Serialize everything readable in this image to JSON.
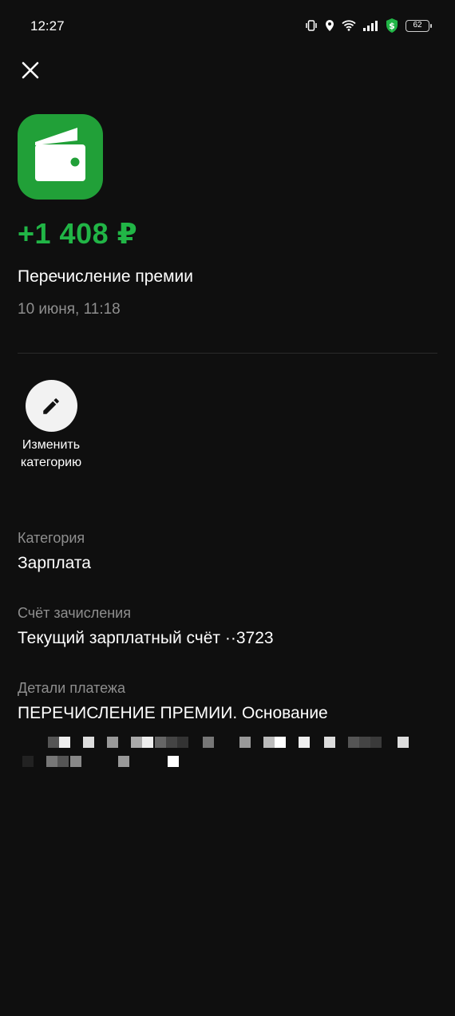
{
  "status_bar": {
    "time": "12:27",
    "battery": "62",
    "icons": [
      "vibrate-icon",
      "location-icon",
      "wifi-icon",
      "signal-icon",
      "shield-dollar-icon",
      "battery-icon"
    ]
  },
  "header": {
    "close_icon": "close-icon",
    "app_icon": "wallet-icon"
  },
  "transaction": {
    "amount": "+1 408 ₽",
    "title": "Перечисление премии",
    "date": "10 июня, 11:18"
  },
  "actions": {
    "change_category_line1": "Изменить",
    "change_category_line2": "категорию"
  },
  "details": {
    "category_label": "Категория",
    "category_value": "Зарплата",
    "account_label": "Счёт зачисления",
    "account_value": "Текущий зарплатный счёт ··3723",
    "payment_label": "Детали платежа",
    "payment_value": "ПЕРЕЧИСЛЕНИЕ ПРЕМИИ. Основание"
  },
  "colors": {
    "background": "#0f0f0f",
    "accent_green": "#21b546",
    "tile_green": "#21a038",
    "secondary_text": "#8e8e8e"
  }
}
